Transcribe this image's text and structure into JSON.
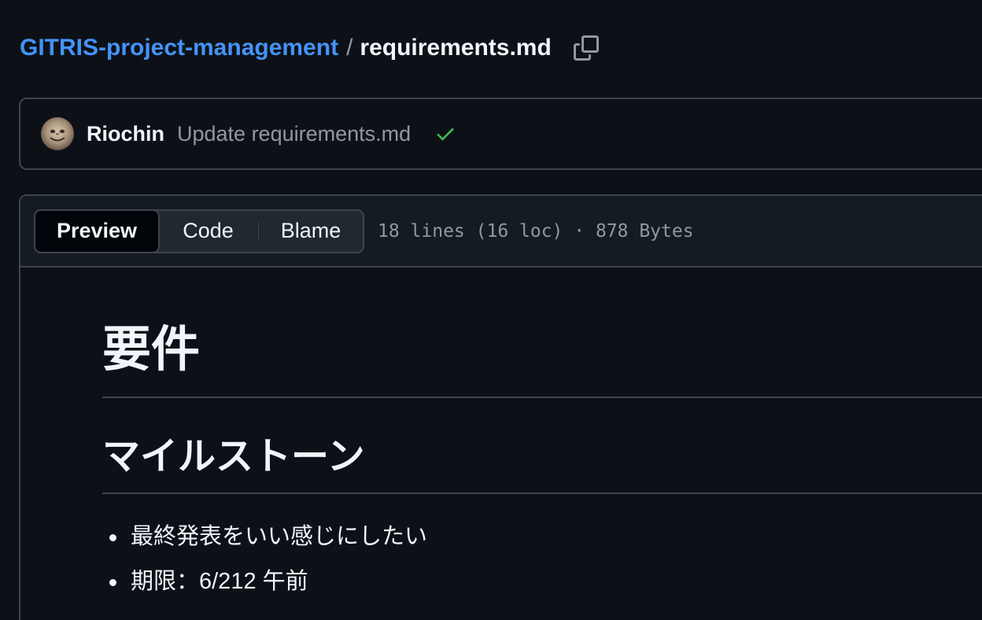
{
  "breadcrumb": {
    "repo": "GITRIS-project-management",
    "separator": "/",
    "file": "requirements.md"
  },
  "commit": {
    "author": "Riochin",
    "message": "Update requirements.md",
    "status": "success"
  },
  "file_view": {
    "tabs": [
      "Preview",
      "Code",
      "Blame"
    ],
    "active_tab": "Preview",
    "meta": "18 lines (16 loc) · 878 Bytes"
  },
  "markdown": {
    "h1": "要件",
    "h2": "マイルストーン",
    "items": [
      "最終発表をいい感じにしたい",
      "期限：6/212 午前"
    ]
  },
  "icons": {
    "copy": "copy-icon",
    "check": "check-icon",
    "avatar": "avatar"
  },
  "colors": {
    "link": "#4493f8",
    "success": "#3fb950",
    "background": "#0d1117",
    "border": "#3d444d"
  }
}
